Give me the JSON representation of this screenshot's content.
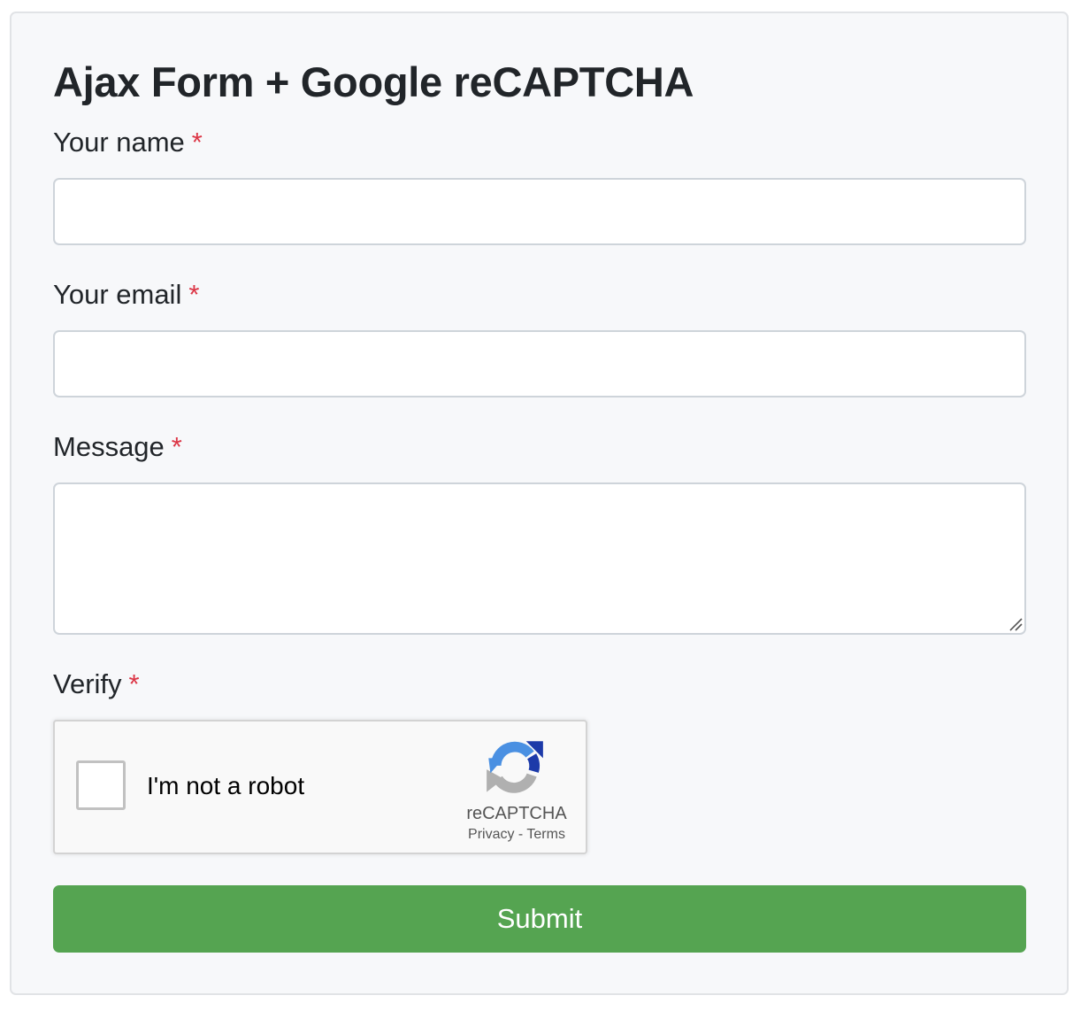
{
  "form": {
    "title": "Ajax Form + Google reCAPTCHA",
    "required_marker": "*",
    "fields": {
      "name": {
        "label": "Your name",
        "value": "",
        "placeholder": ""
      },
      "email": {
        "label": "Your email",
        "value": "",
        "placeholder": ""
      },
      "message": {
        "label": "Message",
        "value": "",
        "placeholder": ""
      },
      "verify": {
        "label": "Verify"
      }
    },
    "submit_label": "Submit"
  },
  "recaptcha": {
    "checkbox_label": "I'm not a robot",
    "checked": false,
    "brand": "reCAPTCHA",
    "privacy_label": "Privacy",
    "separator": "-",
    "terms_label": "Terms",
    "logo_icon": "recaptcha-logo-icon"
  },
  "colors": {
    "required": "#dc3545",
    "submit_bg": "#55a451",
    "card_bg": "#f7f8fa",
    "input_border": "#ced4da"
  }
}
